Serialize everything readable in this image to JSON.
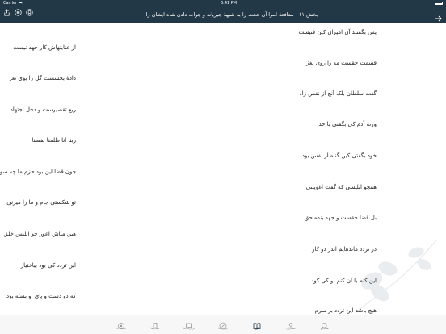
{
  "status_bar": {
    "carrier": "Carrier",
    "time": "6:41 PM"
  },
  "nav": {
    "title": "بخش ۱۱ - مدافعهٔ امرا آن حجت را به شبههٔ جبریانه و جواب دادن شاه ایشان را",
    "icons": [
      "share-icon",
      "list-icon",
      "bookmark-circle-icon"
    ],
    "back_icon": "arrow-right-icon"
  },
  "poem": {
    "right_column": [
      "پس بگفتند آن امیران کین فنیست",
      "قسمت حقست مه را روی نغز",
      "گفت سلطان بلک آنچ از نفس زاد",
      "ورنه آدم کی بگفتی با خدا",
      "خود بگفتی کین گناه از نفس بود",
      "همچو ابلیسی که گفت اغویتنی",
      "بل قضا حقست و جهد بنده حق",
      "در تردد ماندهایم اندر دو کار",
      "این کنم یا آن کنم او کی گود",
      "هیچ باشد این تردد بر سرم"
    ],
    "left_column": [
      "از عنایتهاش کار جهد نیست",
      "دادهٔ بخشست گل را بوی نغز",
      "ریع تقصیرست و دخل اجتهاد",
      "ربنا انا ظلمنا نفسنا",
      "چون قضا این بود حزم ما چه سود",
      "تو شکستی جام و ما را میزنی",
      "هین مباش اعور چو ابلیس خلق",
      "این تردد کی بود بیاختیار",
      "که دو دست و پای او بسته بود"
    ]
  },
  "tabs": [
    {
      "label": "تنظیمات",
      "icon": "settings-icon",
      "active": false
    },
    {
      "label": "نشانه‌ها",
      "icon": "bookmark-icon",
      "active": false
    },
    {
      "label": "برگزیده‌ها",
      "icon": "chat-icon",
      "active": false
    },
    {
      "label": "نوشته‌ها",
      "icon": "pen-icon",
      "active": false
    },
    {
      "label": "آثار",
      "icon": "book-icon",
      "active": true
    },
    {
      "label": "شاعران",
      "icon": "user-icon",
      "active": false
    },
    {
      "label": "جستجو",
      "icon": "search-icon",
      "active": false
    }
  ],
  "colors": {
    "nav_background": "#233847",
    "tab_active": "#233847",
    "tab_inactive": "#9a9a9a"
  }
}
